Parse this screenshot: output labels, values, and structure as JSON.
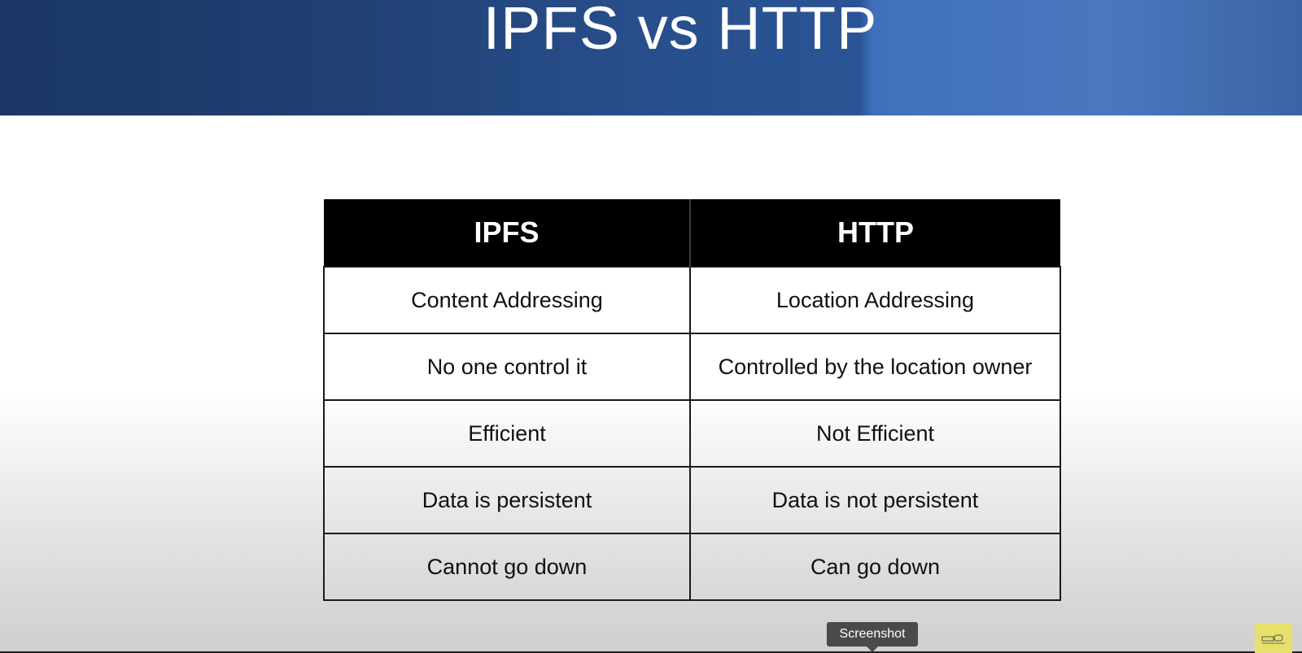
{
  "slide": {
    "title": "IPFS vs HTTP"
  },
  "table": {
    "headers": [
      "IPFS",
      "HTTP"
    ],
    "rows": [
      [
        "Content Addressing",
        "Location Addressing"
      ],
      [
        "No one control it",
        "Controlled by the location owner"
      ],
      [
        "Efficient",
        "Not Efficient"
      ],
      [
        "Data is persistent",
        "Data is not persistent"
      ],
      [
        "Cannot go down",
        "Can go down"
      ]
    ]
  },
  "tooltip": {
    "label": "Screenshot"
  },
  "icons": {
    "logo": "channel-logo-icon",
    "tooltip_arrow": "tooltip-arrow-icon"
  },
  "colors": {
    "banner_dark": "#1b3664",
    "banner_light": "#4a78bf",
    "header_bg": "#000000",
    "logo_bg": "#e8e06a"
  }
}
